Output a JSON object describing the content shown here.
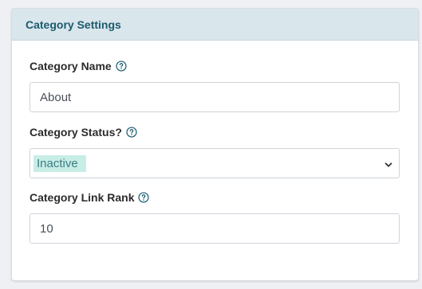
{
  "panel": {
    "title": "Category Settings"
  },
  "fields": {
    "name": {
      "label": "Category Name",
      "value": "About"
    },
    "status": {
      "label": "Category Status?",
      "selected": "Inactive"
    },
    "rank": {
      "label": "Category Link Rank",
      "value": "10"
    }
  },
  "icons": {
    "help": "question-circle-icon",
    "dropdown": "chevron-down-icon"
  },
  "colors": {
    "header_bg": "#d9e6ec",
    "header_text": "#1a5b6e",
    "help_icon": "#1a5b6e",
    "selected_highlight": "#c8ede6"
  }
}
